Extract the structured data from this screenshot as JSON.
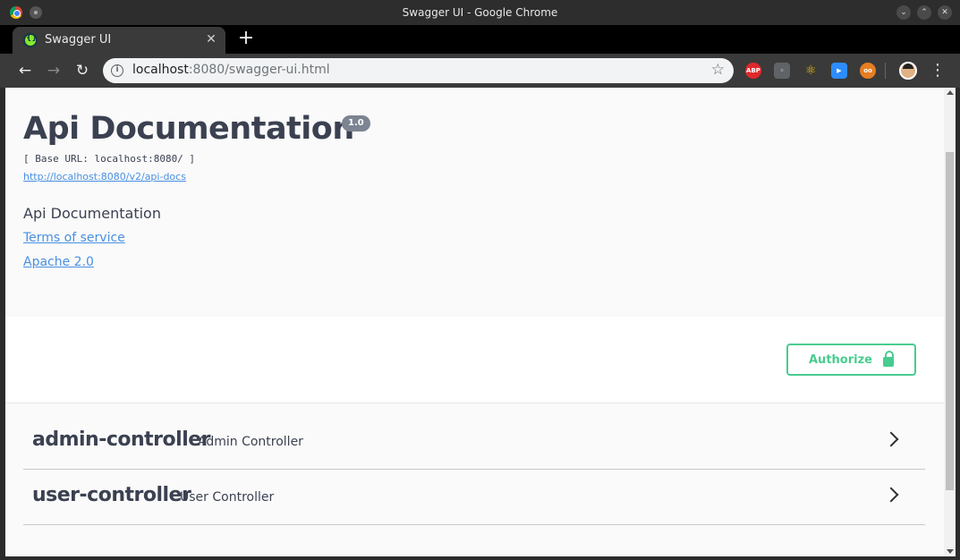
{
  "window": {
    "title": "Swagger UI - Google Chrome",
    "controls": [
      "minimize",
      "maximize",
      "close"
    ]
  },
  "tab": {
    "title": "Swagger UI",
    "close_glyph": "✕",
    "new_tab_glyph": "+"
  },
  "toolbar": {
    "back_glyph": "←",
    "forward_glyph": "→",
    "reload_glyph": "↻",
    "url_host": "localhost",
    "url_rest": ":8080/swagger-ui.html",
    "star_glyph": "☆",
    "extensions": [
      "ABP",
      "",
      "",
      "",
      ""
    ],
    "menu_glyph": "⋮"
  },
  "info": {
    "title": "Api Documentation",
    "version": "1.0",
    "base_url": "[ Base URL: localhost:8080/ ]",
    "docs_url": "http://localhost:8080/v2/api-docs",
    "description": "Api Documentation",
    "terms": "Terms of service",
    "license": "Apache 2.0"
  },
  "auth": {
    "button_label": "Authorize"
  },
  "tags": [
    {
      "name": "admin-controller",
      "description": "Admin Controller"
    },
    {
      "name": "user-controller",
      "description": "User Controller"
    }
  ],
  "colors": {
    "accent_green": "#49cc90",
    "link_blue": "#4990e2",
    "text_dark": "#3b4151"
  }
}
